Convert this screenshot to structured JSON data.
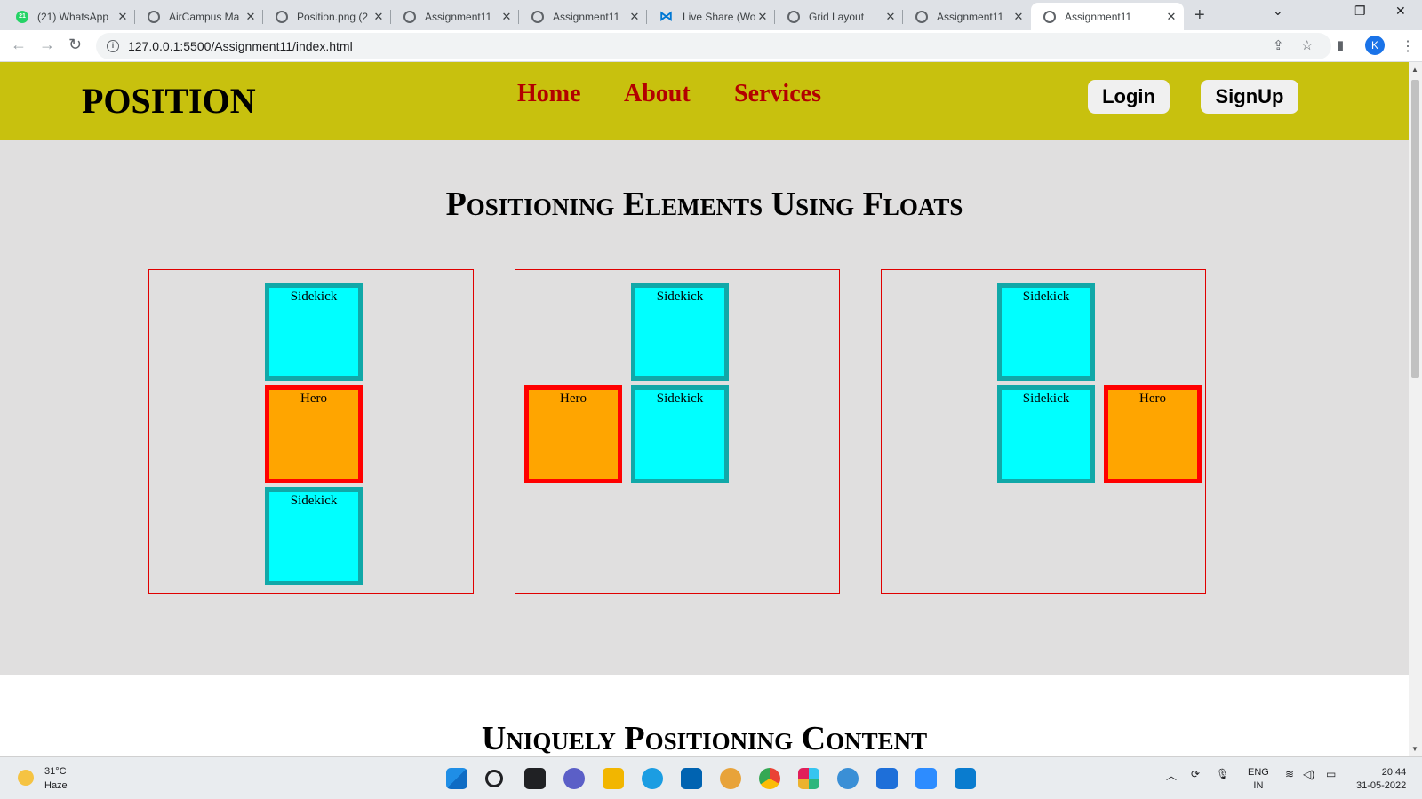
{
  "browser": {
    "tabs": [
      {
        "title": "(21) WhatsApp",
        "icon": "whatsapp-icon",
        "badge": "21"
      },
      {
        "title": "AirCampus Ma",
        "icon": "globe-icon"
      },
      {
        "title": "Position.png (2",
        "icon": "globe-icon"
      },
      {
        "title": "Assignment11",
        "icon": "globe-icon"
      },
      {
        "title": "Assignment11",
        "icon": "globe-icon"
      },
      {
        "title": "Live Share (Wor",
        "icon": "vscode-icon"
      },
      {
        "title": "Grid Layout",
        "icon": "globe-icon"
      },
      {
        "title": "Assignment11",
        "icon": "globe-icon"
      },
      {
        "title": "Assignment11",
        "icon": "globe-icon",
        "active": true
      }
    ],
    "close_glyph": "✕",
    "new_tab_glyph": "+",
    "url": "127.0.0.1:5500/Assignment11/index.html",
    "profile_initial": "K"
  },
  "site": {
    "brand": "POSITION",
    "nav": [
      "Home",
      "About",
      "Services"
    ],
    "login_label": "Login",
    "signup_label": "SignUp",
    "colors": {
      "header_bg": "#c8c10e",
      "nav_link": "#b30000",
      "section_bg": "#e0dfdf",
      "sidekick_bg": "#00ffff",
      "sidekick_border": "#11a8a8",
      "hero_bg": "#ffa500",
      "hero_border": "#ff0000"
    }
  },
  "float_section": {
    "title": "Positioning Elements Using Floats",
    "containers": [
      {
        "boxes": [
          "Sidekick",
          "Hero",
          "Sidekick"
        ]
      },
      {
        "boxes": [
          "Sidekick",
          "Hero",
          "Sidekick"
        ]
      },
      {
        "boxes": [
          "Sidekick",
          "Sidekick",
          "Hero"
        ]
      }
    ]
  },
  "unique_section": {
    "title": "Uniquely Positioning Content"
  },
  "taskbar": {
    "weather_temp": "31°C",
    "weather_desc": "Haze",
    "lang_line1": "ENG",
    "lang_line2": "IN",
    "time": "20:44",
    "date": "31-05-2022"
  }
}
